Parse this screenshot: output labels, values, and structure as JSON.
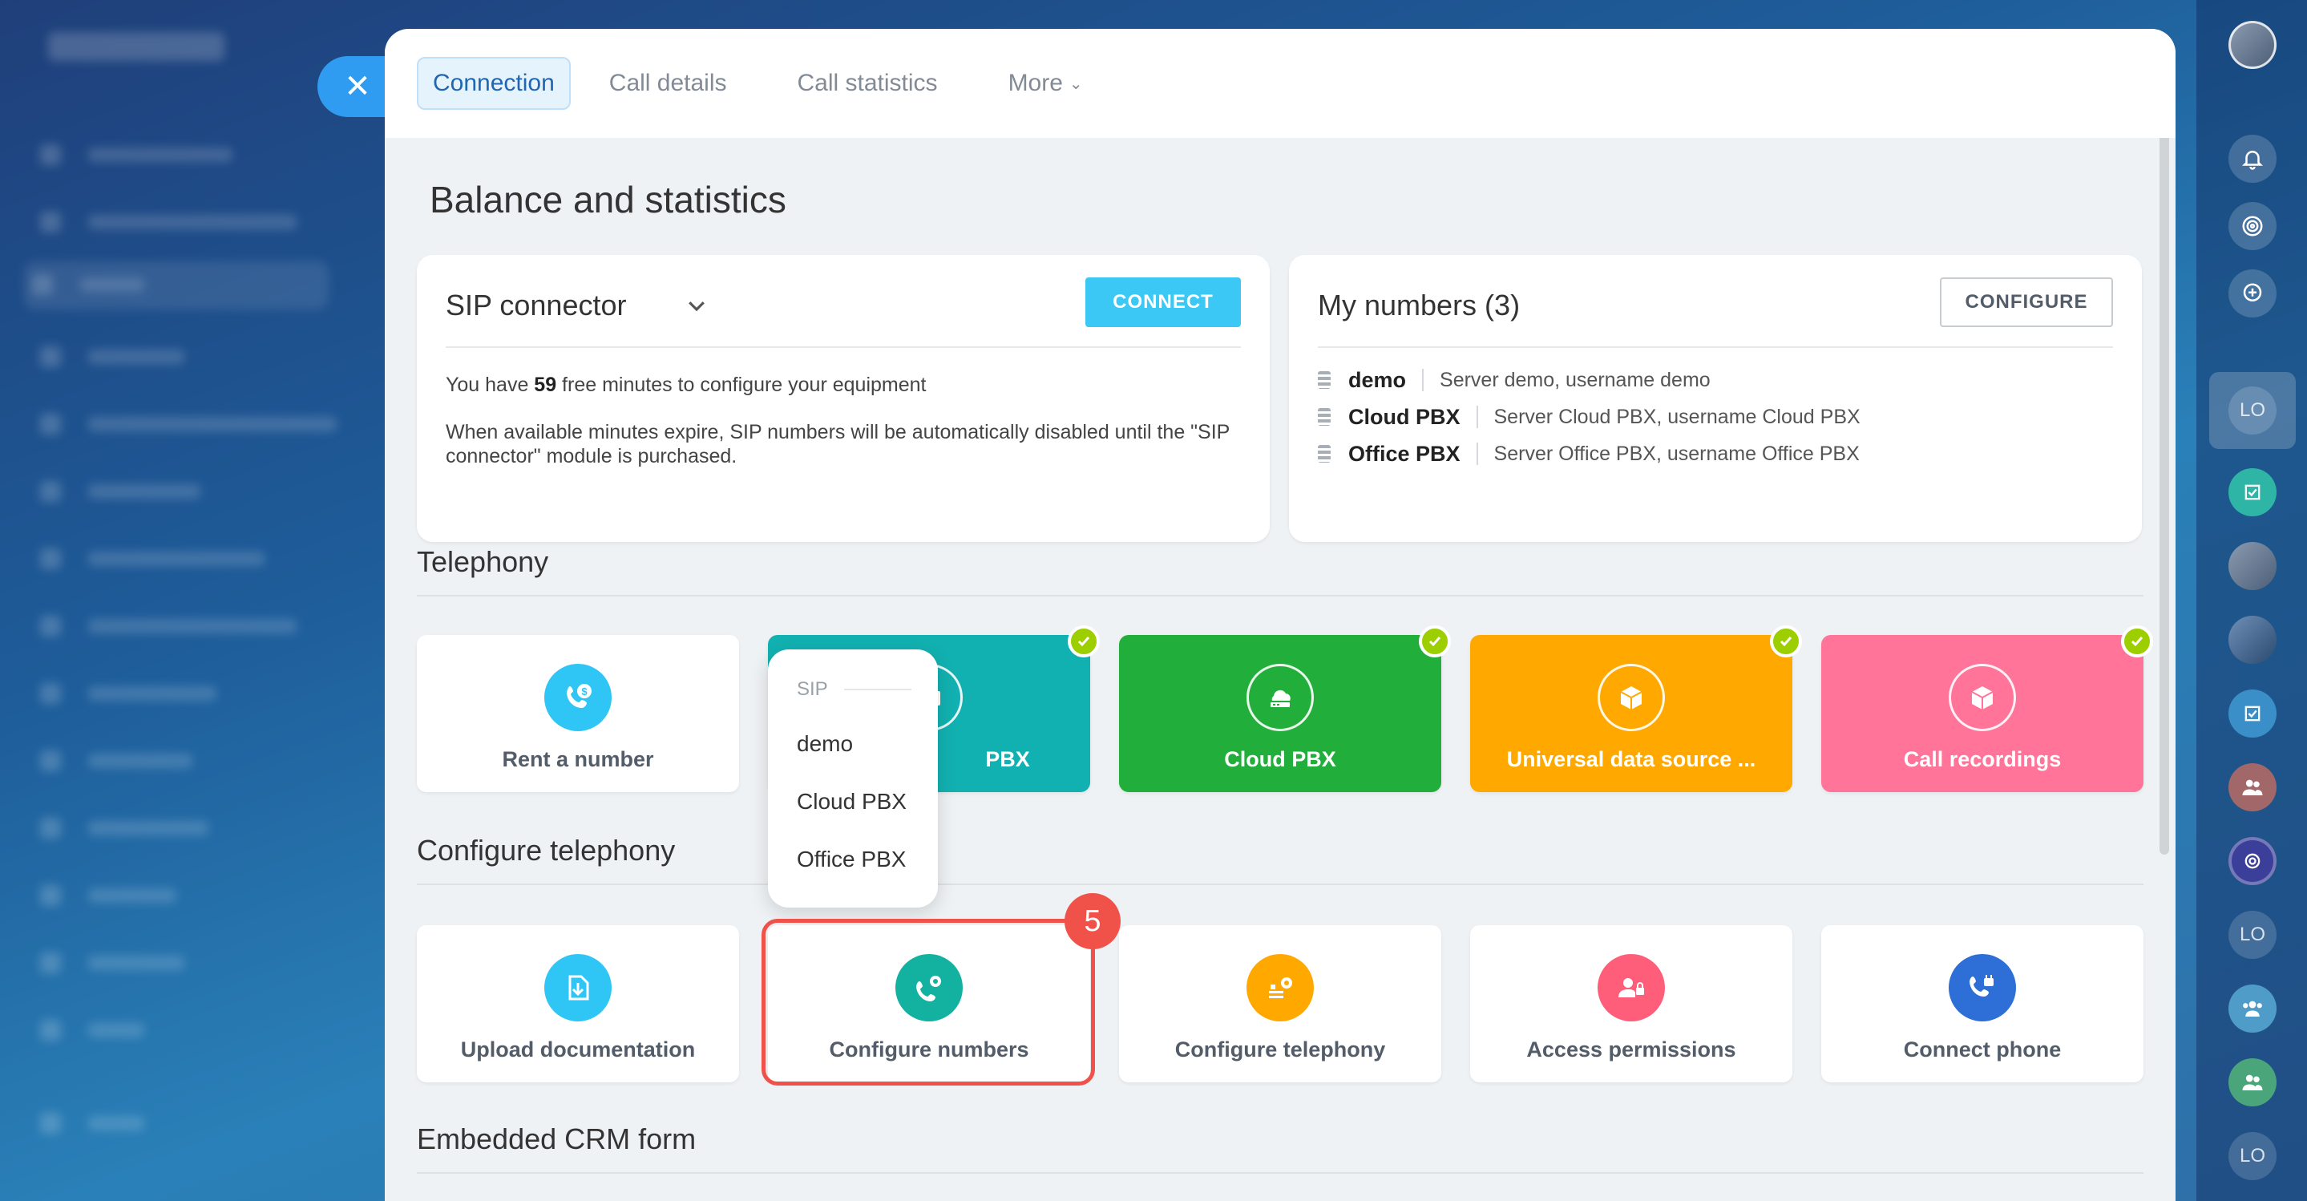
{
  "tabs": [
    {
      "label": "Connection",
      "active": true
    },
    {
      "label": "Call details",
      "active": false
    },
    {
      "label": "Call statistics",
      "active": false
    },
    {
      "label": "More",
      "active": false
    }
  ],
  "page_title": "Balance and statistics",
  "sip_card": {
    "title": "SIP connector",
    "connect_label": "CONNECT",
    "free_minutes_prefix": "You have ",
    "free_minutes": "59",
    "free_minutes_suffix": " free minutes to configure your equipment",
    "notice": "When available minutes expire, SIP numbers will be automatically disabled until the \"SIP connector\" module is purchased."
  },
  "numbers_card": {
    "title": "My numbers (3)",
    "configure_label": "CONFIGURE",
    "numbers": [
      {
        "name": "demo",
        "desc": "Server demo, username demo"
      },
      {
        "name": "Cloud PBX",
        "desc": "Server Cloud PBX, username Cloud PBX"
      },
      {
        "name": "Office PBX",
        "desc": "Server Office PBX, username Office PBX"
      }
    ]
  },
  "sections": {
    "telephony": "Telephony",
    "configure": "Configure telephony",
    "crm_form": "Embedded CRM form"
  },
  "telephony_tiles": [
    {
      "label": "Rent a number",
      "icon": "phone-dollar-icon",
      "color": "#2fc6f6",
      "checked": false
    },
    {
      "label": "PBX",
      "icon": "office-pbx-icon",
      "color": "#12b1b1",
      "checked": true
    },
    {
      "label": "Cloud PBX",
      "icon": "cloud-pbx-icon",
      "color": "#21ae3a",
      "checked": true
    },
    {
      "label": "Universal data source ...",
      "icon": "box-icon",
      "color": "#ffa900",
      "checked": true
    },
    {
      "label": "Call recordings",
      "icon": "box-icon",
      "color": "#ff7498",
      "checked": true
    }
  ],
  "configure_tiles": [
    {
      "label": "Upload documentation",
      "icon": "upload-doc-icon",
      "color": "#2fc6f6"
    },
    {
      "label": "Configure numbers",
      "icon": "phone-gear-icon",
      "color": "#12b1a0"
    },
    {
      "label": "Configure telephony",
      "icon": "list-gear-icon",
      "color": "#ffa900"
    },
    {
      "label": "Access permissions",
      "icon": "user-lock-icon",
      "color": "#ff5e7a"
    },
    {
      "label": "Connect phone",
      "icon": "phone-plug-icon",
      "color": "#2d6fd6"
    }
  ],
  "dropdown": {
    "header": "SIP",
    "items": [
      "demo",
      "Cloud PBX",
      "Office PBX"
    ]
  },
  "step_badge": "5",
  "rail": {
    "lo_label": "LO"
  }
}
